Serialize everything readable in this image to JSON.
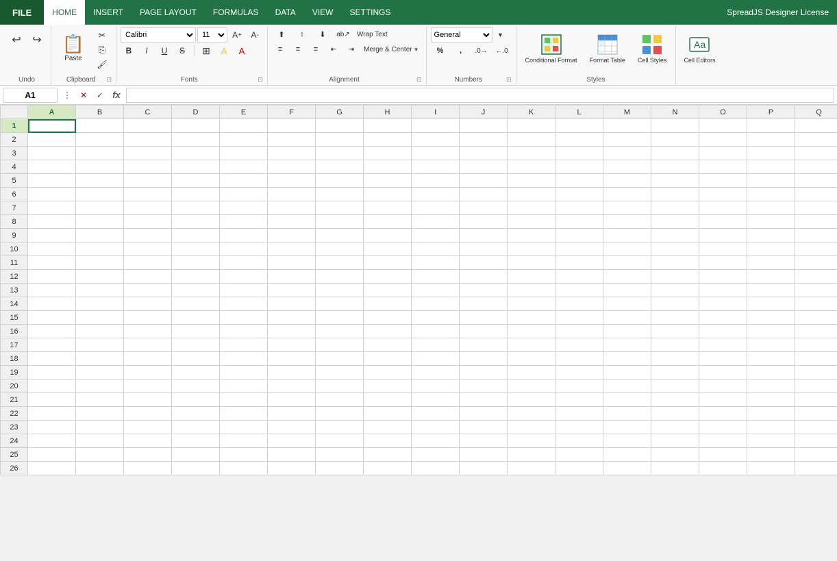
{
  "app": {
    "title": "SpreadJS Designer License"
  },
  "menu": {
    "file_label": "FILE",
    "items": [
      {
        "id": "home",
        "label": "HOME",
        "active": true
      },
      {
        "id": "insert",
        "label": "INSERT",
        "active": false
      },
      {
        "id": "page_layout",
        "label": "PAGE LAYOUT",
        "active": false
      },
      {
        "id": "formulas",
        "label": "FORMULAS",
        "active": false
      },
      {
        "id": "data",
        "label": "DATA",
        "active": false
      },
      {
        "id": "view",
        "label": "VIEW",
        "active": false
      },
      {
        "id": "settings",
        "label": "SETTINGS",
        "active": false
      },
      {
        "id": "license",
        "label": "SpreadJS Designer License",
        "active": false
      }
    ]
  },
  "ribbon": {
    "groups": {
      "undo": {
        "label": ""
      },
      "clipboard": {
        "label": "Clipboard",
        "paste": "Paste"
      },
      "fonts": {
        "label": "Fonts",
        "font_family": "Calibri",
        "font_size": "11",
        "bold": "B",
        "italic": "I",
        "underline": "U",
        "strikethrough": "S",
        "border_btn": "⊞",
        "fill_color": "A",
        "font_color": "A"
      },
      "alignment": {
        "label": "Alignment",
        "wrap_text": "Wrap Text",
        "merge_center": "Merge & Center"
      },
      "numbers": {
        "label": "Numbers",
        "format": "General"
      },
      "styles": {
        "label": "Styles",
        "conditional_format": "Conditional Format",
        "format_table": "Format Table",
        "cell_styles": "Cell Styles"
      },
      "cells": {
        "label": "",
        "cell_editors": "Cell Editors"
      }
    }
  },
  "formula_bar": {
    "cell_ref": "A1",
    "formula_placeholder": ""
  },
  "grid": {
    "selected_cell": {
      "col": "A",
      "row": 1
    },
    "col_headers": [
      "A",
      "B",
      "C",
      "D",
      "E",
      "F",
      "G",
      "H",
      "I",
      "J",
      "K",
      "L",
      "M",
      "N",
      "O",
      "P",
      "Q"
    ],
    "row_count": 26,
    "row_headers": [
      1,
      2,
      3,
      4,
      5,
      6,
      7,
      8,
      9,
      10,
      11,
      12,
      13,
      14,
      15,
      16,
      17,
      18,
      19,
      20,
      21,
      22,
      23,
      24,
      25,
      26
    ]
  }
}
